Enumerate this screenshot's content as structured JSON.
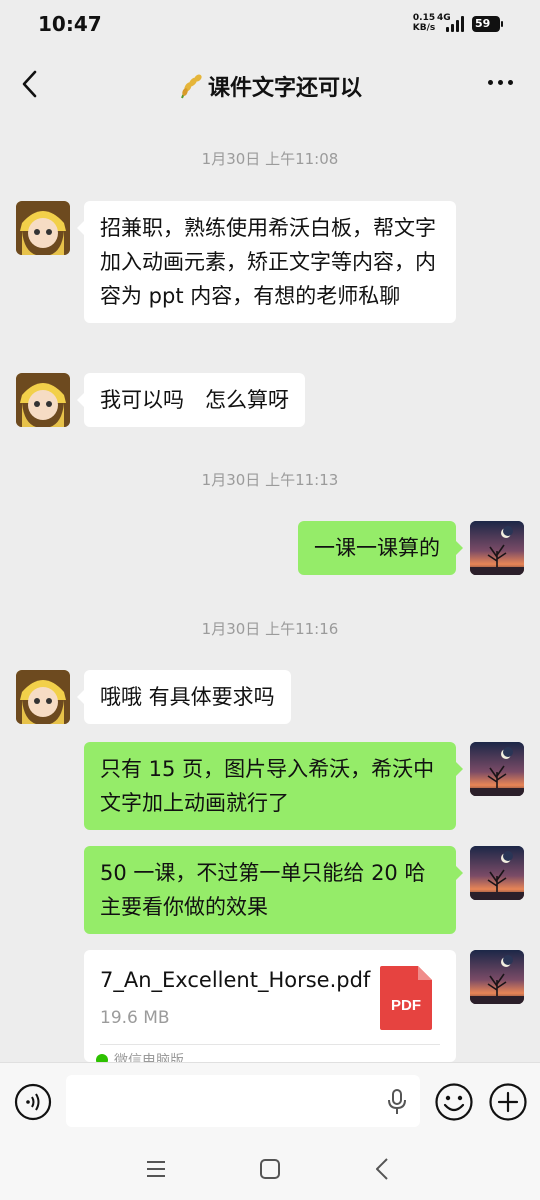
{
  "status_bar": {
    "time": "10:47",
    "net_speed_value": "0.15",
    "net_speed_unit": "KB/s",
    "network": "4G",
    "battery": "59"
  },
  "header": {
    "title": "课件文字还可以",
    "title_icon": "rice-ear-icon",
    "back_icon": "chevron-left-icon",
    "more_icon": "more-dots-icon"
  },
  "messages": {
    "ts1": "1月30日 上午11:08",
    "m1": "招兼职，熟练使用希沃白板，帮文字加入动画元素，矫正文字等内容，内容为 ppt 内容，有想的老师私聊",
    "m2": "我可以吗　怎么算呀",
    "ts2": "1月30日 上午11:13",
    "m3": "一课一课算的",
    "ts3": "1月30日 上午11:16",
    "m4": "哦哦 有具体要求吗",
    "m5": "只有 15 页，图片导入希沃，希沃中文字加上动画就行了",
    "m6": "50 一课，不过第一单只能给 20 哈 主要看你做的效果",
    "file": {
      "name": "7_An_Excellent_Horse.pdf",
      "size": "19.6 MB",
      "type_label": "PDF",
      "source": "微信电脑版"
    }
  },
  "input_bar": {
    "placeholder": ""
  },
  "colors": {
    "background": "#ededed",
    "bubble_sent": "#95ec69",
    "bubble_received": "#ffffff",
    "pdf_red": "#e64340"
  }
}
